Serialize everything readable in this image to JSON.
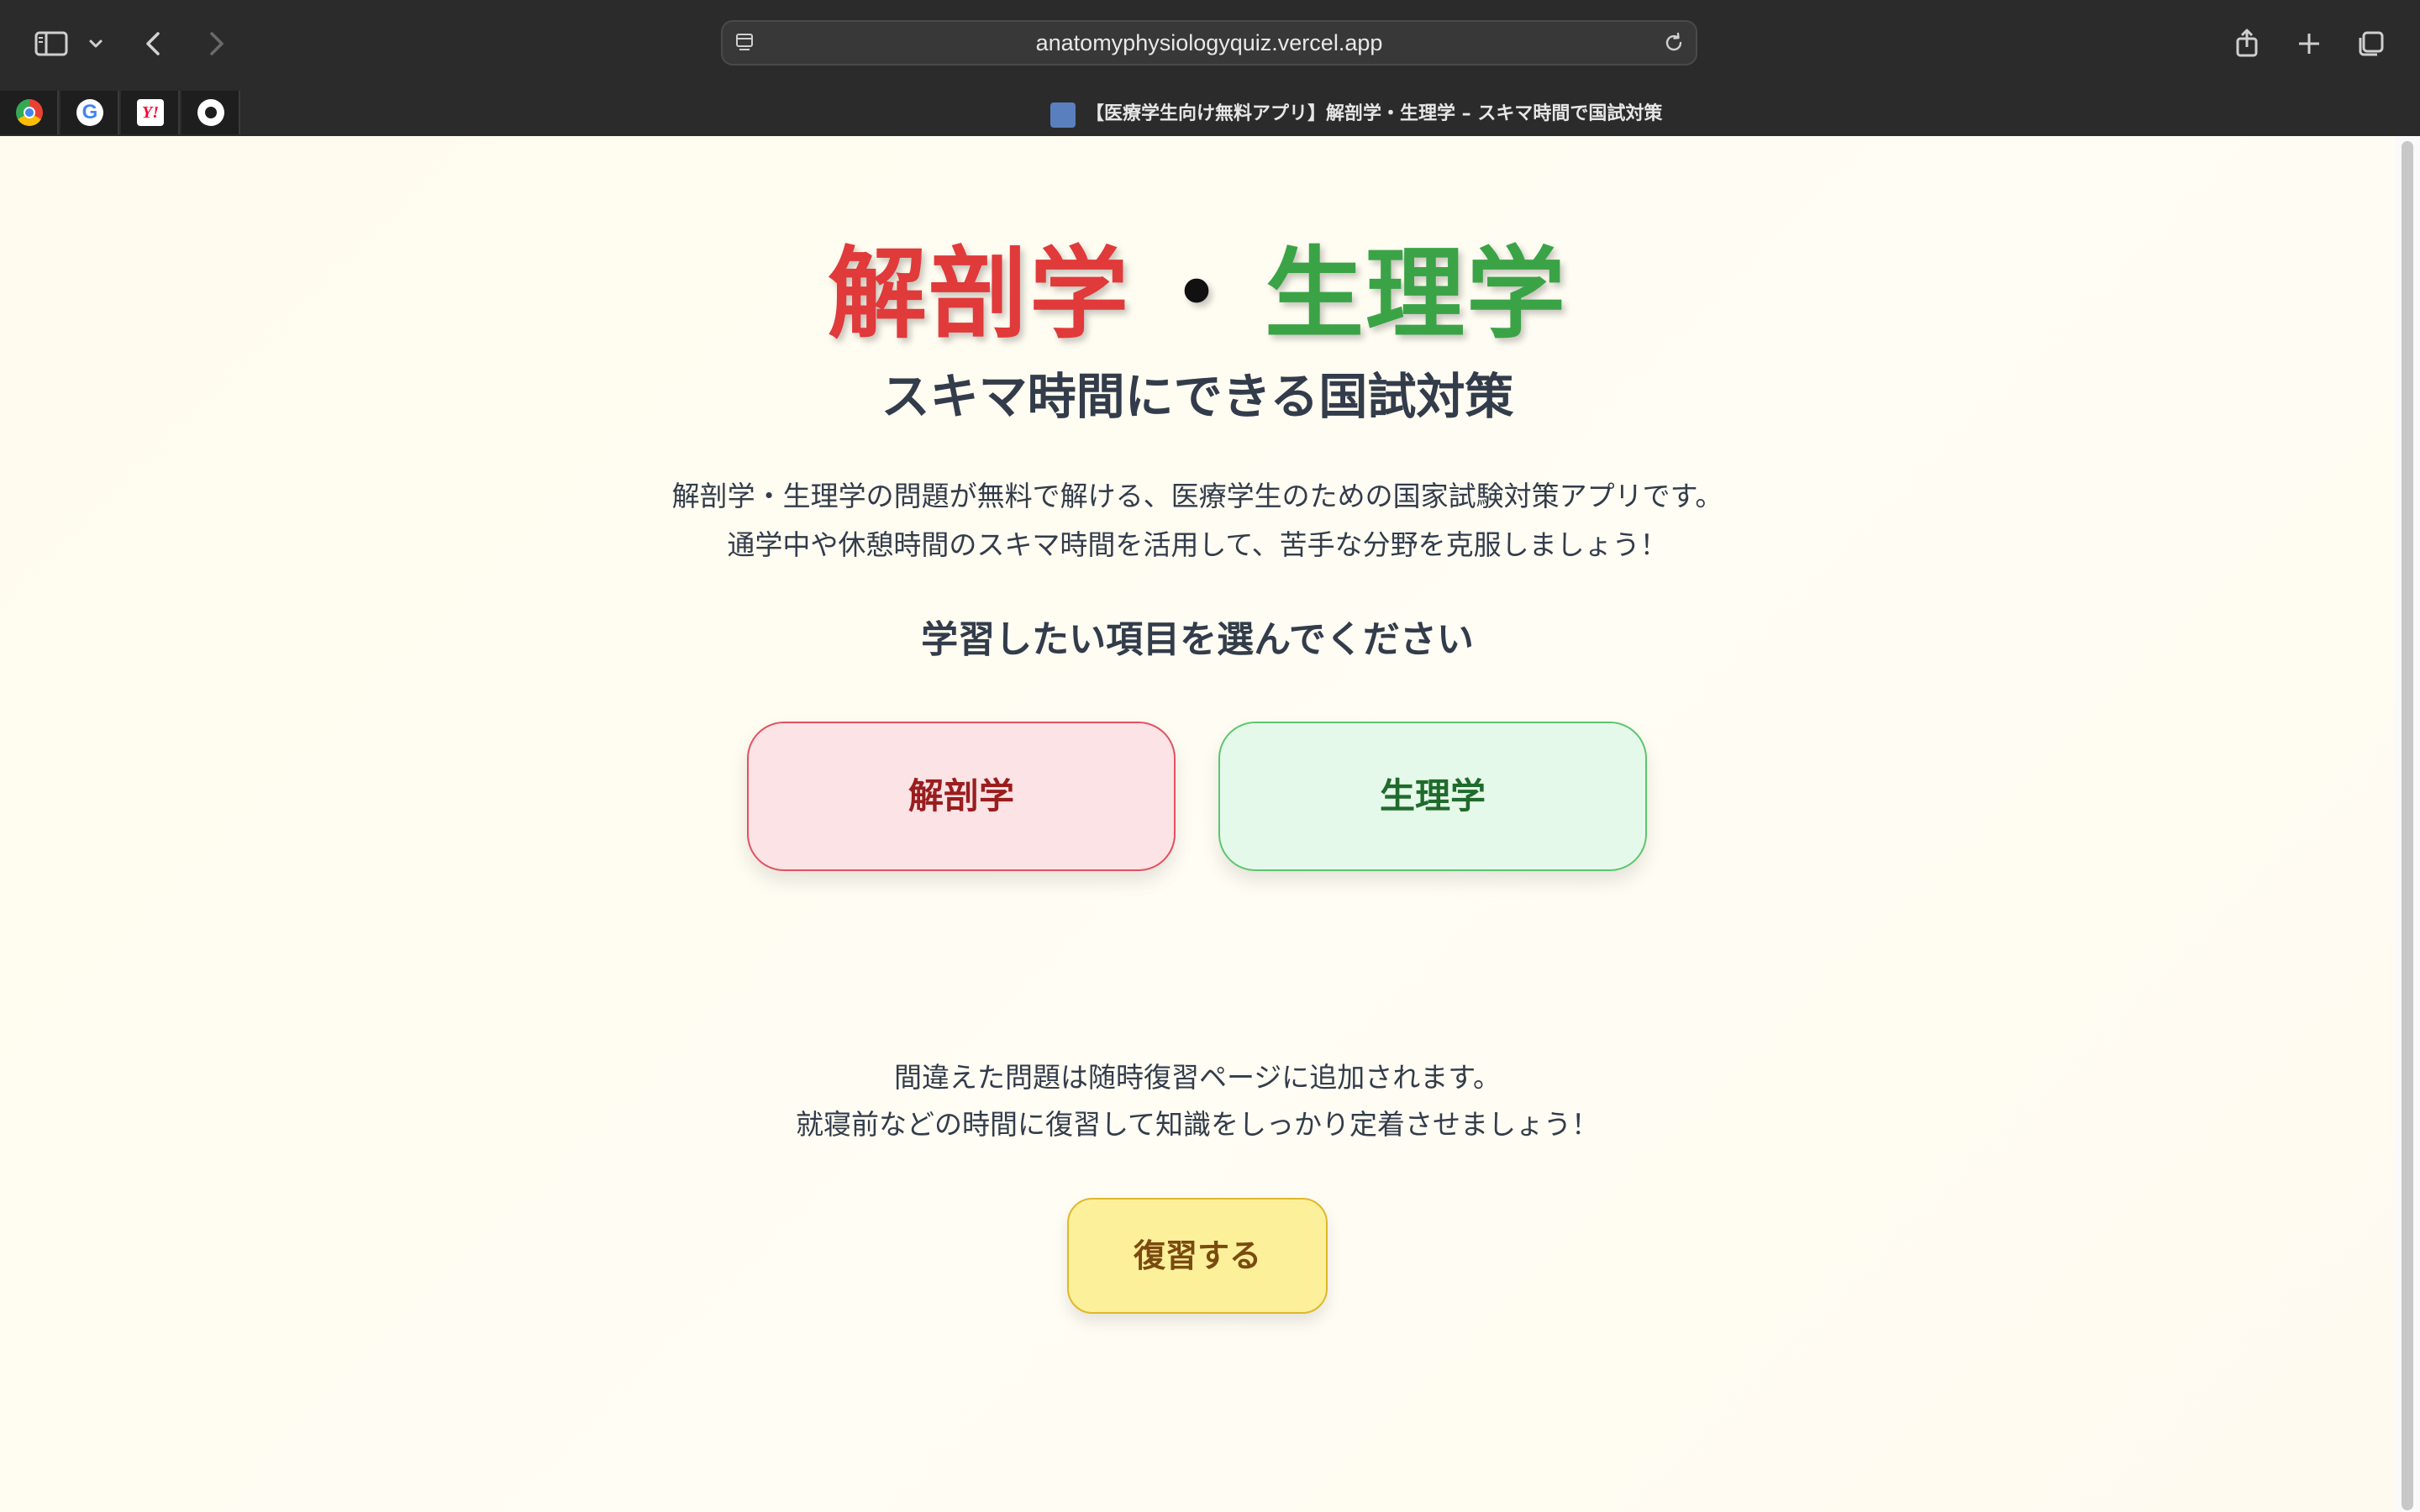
{
  "browser": {
    "url": "anatomyphysiologyquiz.vercel.app",
    "active_tab_title": "【医療学生向け無料アプリ】解剖学・生理学 – スキマ時間で国試対策",
    "pinned_tabs": [
      "chrome-icon",
      "google-icon",
      "yahoo-icon",
      "apple-icon"
    ]
  },
  "page": {
    "heading": {
      "anatomy": "解剖学",
      "separator": "・",
      "physiology": "生理学"
    },
    "subtitle": "スキマ時間にできる国試対策",
    "description": [
      "解剖学・生理学の問題が無料で解ける、医療学生のための国家試験対策アプリです。",
      "通学中や休憩時間のスキマ時間を活用して、苦手な分野を克服しましょう！"
    ],
    "prompt": "学習したい項目を選んでください",
    "choices": {
      "anatomy": "解剖学",
      "physiology": "生理学"
    },
    "review_text": [
      "間違えた問題は随時復習ページに追加されます。",
      "就寝前などの時間に復習して知識をしっかり定着させましょう！"
    ],
    "review_button": "復習する"
  },
  "colors": {
    "anatomy_accent": "#e03a3a",
    "physiology_accent": "#3aa346",
    "review_accent": "#fdf09a",
    "chrome_bg": "#2b2b2b",
    "page_bg": "#fffdf0"
  }
}
